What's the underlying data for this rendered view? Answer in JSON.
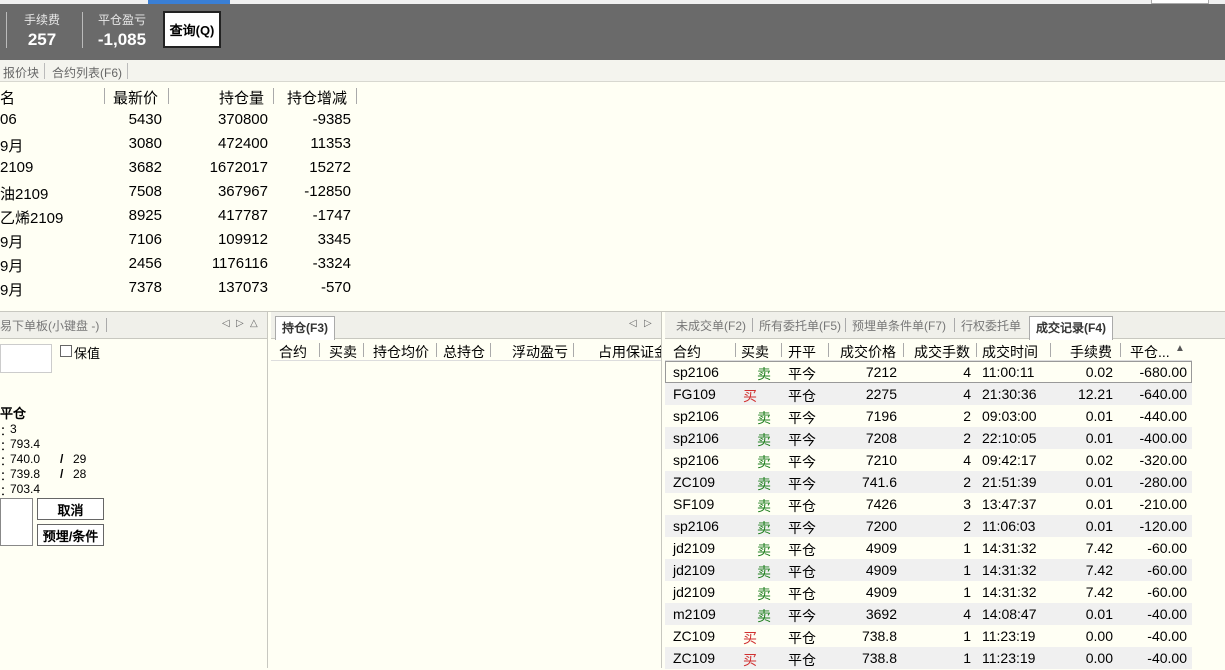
{
  "header": {
    "fee_label": "手续费",
    "fee_value": "257",
    "close_pnl_label": "平仓盈亏",
    "close_pnl_value": "-1,085",
    "query_button": "查询(Q)"
  },
  "top_tabs": [
    "报价块",
    "合约列表(F6)"
  ],
  "quote_table": {
    "headers": [
      "名",
      "最新价",
      "持仓量",
      "持仓增减"
    ],
    "rows": [
      [
        "06",
        "5430",
        "370800",
        "-9385"
      ],
      [
        "9月",
        "3080",
        "472400",
        "11353"
      ],
      [
        "2109",
        "3682",
        "1672017",
        "15272"
      ],
      [
        "油2109",
        "7508",
        "367967",
        "-12850"
      ],
      [
        "乙烯2109",
        "8925",
        "417787",
        "-1747"
      ],
      [
        "9月",
        "7106",
        "109912",
        "3345"
      ],
      [
        "9月",
        "2456",
        "1176116",
        "-3324"
      ],
      [
        "9月",
        "7378",
        "137073",
        "-570"
      ]
    ]
  },
  "order_panel": {
    "title": "易下单板(小键盘 -)",
    "keep_margin_label": "保值",
    "close_label": "平仓",
    "lines": [
      {
        "label": "：",
        "val": "3",
        "extra": ""
      },
      {
        "label": "：",
        "val": "793.4",
        "extra": ""
      },
      {
        "label": "：",
        "val": "740.0",
        "extra": "29"
      },
      {
        "label": "：",
        "val": "739.8",
        "extra": "28"
      },
      {
        "label": "：",
        "val": "703.4",
        "extra": ""
      }
    ],
    "cancel_button": "取消",
    "preset_button": "预埋/条件"
  },
  "position_panel": {
    "tab": "持仓(F3)",
    "headers": [
      "合约",
      "买卖",
      "持仓均价",
      "总持仓",
      "浮动盈亏",
      "占用保证金"
    ]
  },
  "trade_panel": {
    "tabs": [
      "未成交单(F2)",
      "所有委托单(F5)",
      "预埋单条件单(F7)",
      "行权委托单",
      "成交记录(F4)"
    ],
    "headers": [
      "合约",
      "买卖",
      "开平",
      "成交价格",
      "成交手数",
      "成交时间",
      "手续费",
      "平仓..."
    ],
    "rows": [
      [
        "sp2106",
        "卖",
        "平今",
        "7212",
        "4",
        "11:00:11",
        "0.02",
        "-680.00"
      ],
      [
        "FG109",
        "买",
        "平仓",
        "2275",
        "4",
        "21:30:36",
        "12.21",
        "-640.00"
      ],
      [
        "sp2106",
        "卖",
        "平今",
        "7196",
        "2",
        "09:03:00",
        "0.01",
        "-440.00"
      ],
      [
        "sp2106",
        "卖",
        "平今",
        "7208",
        "2",
        "22:10:05",
        "0.01",
        "-400.00"
      ],
      [
        "sp2106",
        "卖",
        "平今",
        "7210",
        "4",
        "09:42:17",
        "0.02",
        "-320.00"
      ],
      [
        "ZC109",
        "卖",
        "平今",
        "741.6",
        "2",
        "21:51:39",
        "0.01",
        "-280.00"
      ],
      [
        "SF109",
        "卖",
        "平仓",
        "7426",
        "3",
        "13:47:37",
        "0.01",
        "-210.00"
      ],
      [
        "sp2106",
        "卖",
        "平今",
        "7200",
        "2",
        "11:06:03",
        "0.01",
        "-120.00"
      ],
      [
        "jd2109",
        "卖",
        "平仓",
        "4909",
        "1",
        "14:31:32",
        "7.42",
        "-60.00"
      ],
      [
        "jd2109",
        "卖",
        "平仓",
        "4909",
        "1",
        "14:31:32",
        "7.42",
        "-60.00"
      ],
      [
        "jd2109",
        "卖",
        "平仓",
        "4909",
        "1",
        "14:31:32",
        "7.42",
        "-60.00"
      ],
      [
        "m2109",
        "卖",
        "平今",
        "3692",
        "4",
        "14:08:47",
        "0.01",
        "-40.00"
      ],
      [
        "ZC109",
        "买",
        "平仓",
        "738.8",
        "1",
        "11:23:19",
        "0.00",
        "-40.00"
      ],
      [
        "ZC109",
        "买",
        "平仓",
        "738.8",
        "1",
        "11:23:19",
        "0.00",
        "-40.00"
      ]
    ]
  }
}
